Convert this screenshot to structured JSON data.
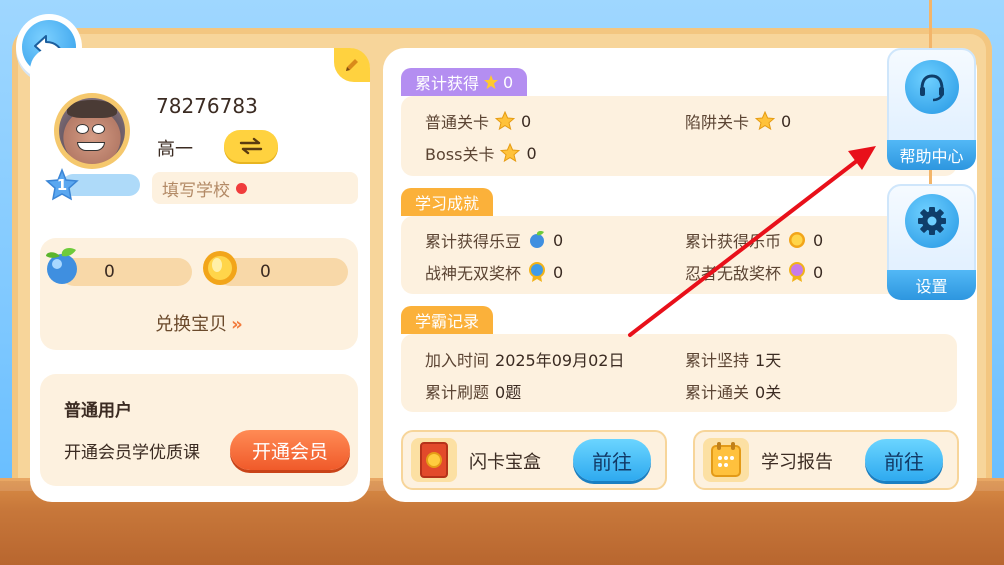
{
  "user": {
    "id": "78276783",
    "grade": "高一",
    "level": "1",
    "school_placeholder": "填写学校"
  },
  "currency": {
    "beans": "0",
    "coins": "0",
    "exchange_label": "兑换宝贝",
    "exchange_arrow": "»"
  },
  "membership": {
    "title": "普通用户",
    "desc": "开通会员学优质课",
    "button": "开通会员"
  },
  "total": {
    "tag_label": "累计获得",
    "tag_value": "0",
    "normal_label": "普通关卡",
    "normal_value": "0",
    "trap_label": "陷阱关卡",
    "trap_value": "0",
    "boss_label": "Boss关卡",
    "boss_value": "0"
  },
  "achievements": {
    "tag_label": "学习成就",
    "beans_label": "累计获得乐豆",
    "beans_value": "0",
    "coins_label": "累计获得乐币",
    "coins_value": "0",
    "war_label": "战神无双奖杯",
    "war_value": "0",
    "ninja_label": "忍者无敌奖杯",
    "ninja_value": "0"
  },
  "records": {
    "tag_label": "学霸记录",
    "join_label": "加入时间",
    "join_value": "2025年09月02日",
    "streak_label": "累计坚持",
    "streak_value": "1天",
    "questions_label": "累计刷题",
    "questions_value": "0题",
    "cleared_label": "累计通关",
    "cleared_value": "0关"
  },
  "cards": {
    "flash_label": "闪卡宝盒",
    "flash_button": "前往",
    "report_label": "学习报告",
    "report_button": "前往"
  },
  "side": {
    "help_label": "帮助中心",
    "settings_label": "设置"
  },
  "colors": {
    "accent_blue": "#2e9be8",
    "accent_orange": "#f05a2a",
    "tag_purple": "#b48ef1",
    "tag_orange": "#fbb13a",
    "annotation_arrow": "#e8101a"
  }
}
